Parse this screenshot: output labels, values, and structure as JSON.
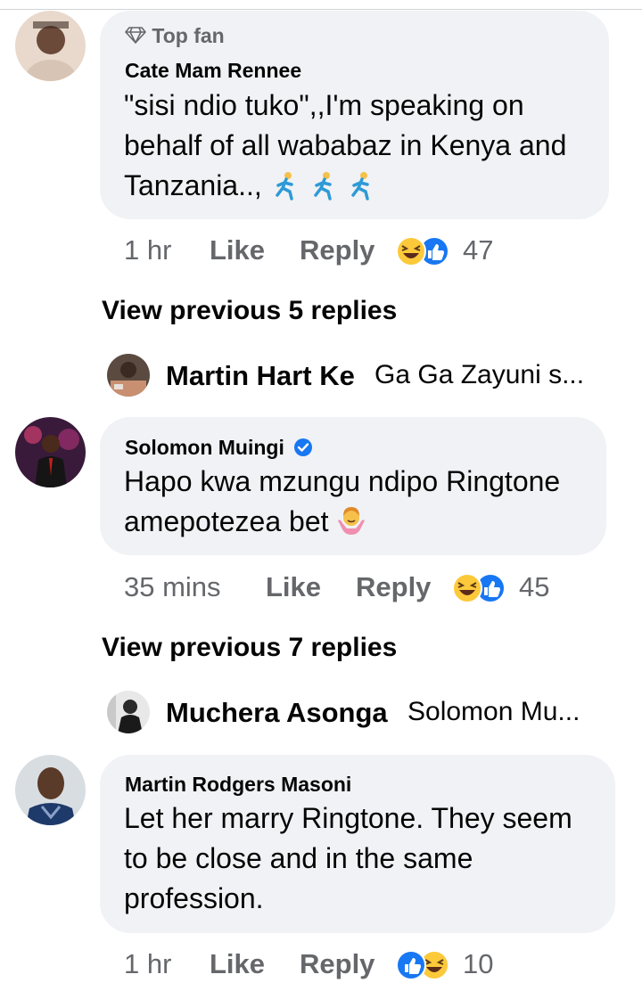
{
  "comments": [
    {
      "badge": "Top fan",
      "author": "Cate Mam Rennee",
      "text_line1": "\"sisi ndio tuko\",,I'm speaking on",
      "text_line2": "behalf of all wababaz in Kenya and",
      "text_line3": "Tanzania..,",
      "time": "1 hr",
      "like": "Like",
      "reply": "Reply",
      "reaction_count": "47",
      "reactions": [
        "haha-icon",
        "like-icon"
      ]
    },
    {
      "author": "Solomon Muingi",
      "verified": true,
      "text_line1": "Hapo kwa mzungu ndipo Ringtone",
      "text_line2": "amepotezea bet",
      "time": "35 mins",
      "like": "Like",
      "reply": "Reply",
      "reaction_count": "45",
      "reactions": [
        "haha-icon",
        "like-icon"
      ]
    },
    {
      "author": "Martin Rodgers Masoni",
      "text_line1": "Let her marry Ringtone. They seem",
      "text_line2": "to be close and in the same",
      "text_line3": "profession.",
      "time": "1 hr",
      "like": "Like",
      "reply": "Reply",
      "reaction_count": "10",
      "reactions": [
        "like-icon",
        "haha-icon"
      ]
    }
  ],
  "view_previous": [
    {
      "label": "View previous 5 replies"
    },
    {
      "label": "View previous 7 replies"
    }
  ],
  "reply_previews": [
    {
      "author": "Martin Hart Ke",
      "text": "Ga Ga Zayuni s..."
    },
    {
      "author": "Muchera Asonga",
      "text": "Solomon Mu..."
    }
  ],
  "colors": {
    "bubble": "#f0f2f5",
    "meta_text": "#65676b",
    "like_blue": "#1877f2",
    "haha_yellow": "#fcc93a"
  }
}
